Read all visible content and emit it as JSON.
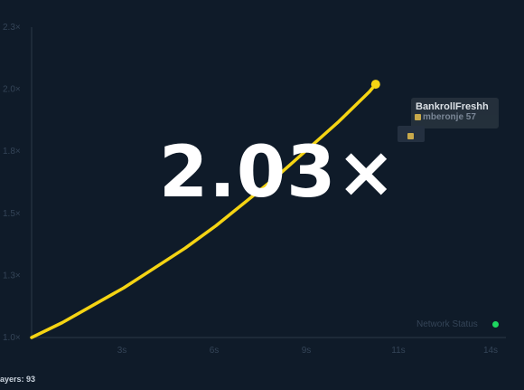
{
  "game": {
    "multiplier_text": "2.03×",
    "current_multiplier": 2.03,
    "current_time_s": 11.2,
    "players_label": "ayers: 93",
    "network_status_label": "Network Status",
    "network_status_color": "#1ed760",
    "curve_color": "#f5d413",
    "background_color": "#0f1b29"
  },
  "players_on_curve": [
    {
      "name": "BankrollFreshh"
    },
    {
      "name": "mberonje",
      "suffix": "57"
    }
  ],
  "chart_data": {
    "type": "line",
    "x_ticks": [
      "3s",
      "6s",
      "9s",
      "11s",
      "14s"
    ],
    "x_tick_values": [
      3,
      6,
      9,
      12,
      15
    ],
    "y_ticks": [
      "1.0×",
      "1.3×",
      "1.5×",
      "1.8×",
      "2.0×",
      "2.3×"
    ],
    "y_tick_values": [
      1.0,
      1.25,
      1.5,
      1.75,
      2.0,
      2.25
    ],
    "xlim": [
      0,
      15
    ],
    "ylim": [
      1.0,
      2.25
    ],
    "series": [
      {
        "x": [
          0,
          1,
          2,
          3,
          4,
          5,
          6,
          7,
          8,
          9,
          10,
          11,
          11.2
        ],
        "y": [
          1.0,
          1.06,
          1.13,
          1.2,
          1.28,
          1.36,
          1.45,
          1.55,
          1.65,
          1.76,
          1.87,
          1.99,
          2.02
        ]
      }
    ]
  }
}
